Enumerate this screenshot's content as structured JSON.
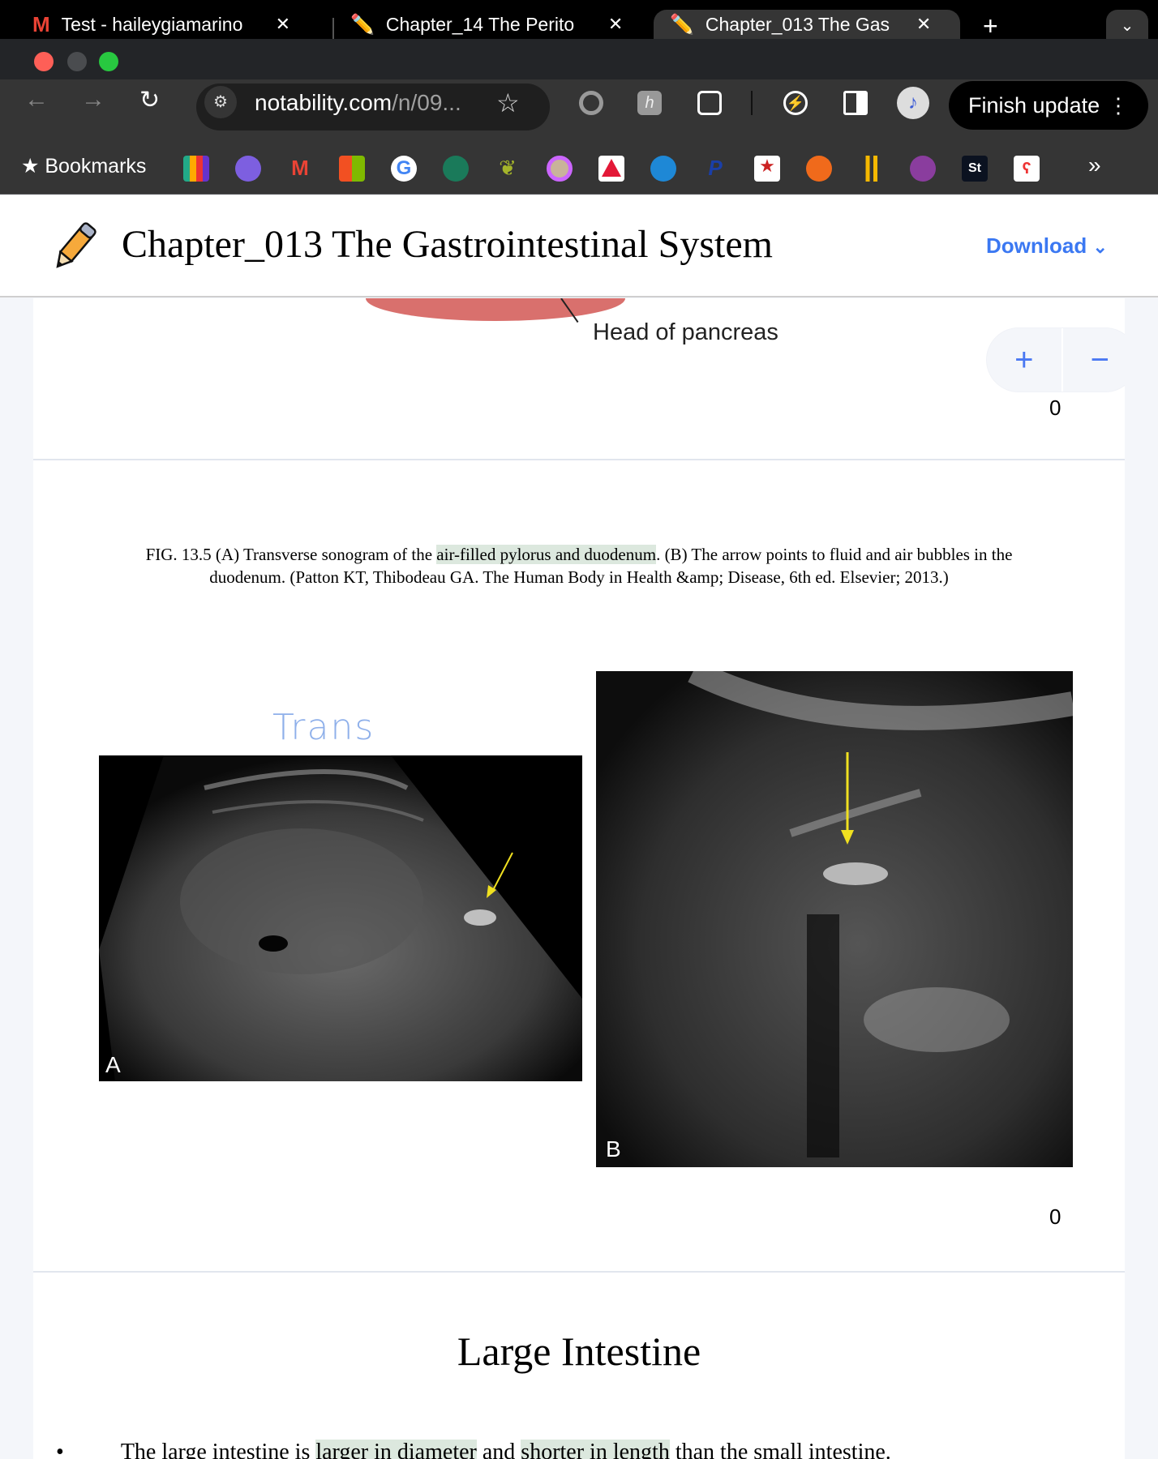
{
  "browser": {
    "tabs": [
      {
        "icon": "gmail-icon",
        "label": "Test - haileygiamarino",
        "active": false
      },
      {
        "icon": "notability-icon",
        "label": "Chapter_14 The Perito",
        "active": false
      },
      {
        "icon": "notability-icon",
        "label": "Chapter_013 The Gas",
        "active": true
      }
    ],
    "new_tab": "+",
    "tab_menu": "⌄",
    "url_domain": "notability.com",
    "url_path": "/n/09...",
    "finish_update": "Finish update",
    "bookmarks_label": "Bookmarks",
    "bookmarks_more": "»"
  },
  "app": {
    "title": "Chapter_013 The Gastrointestinal System",
    "download_label": "Download",
    "accent": "#3b78f2"
  },
  "content": {
    "prev_figure_label": "Head of pancreas",
    "vote_plus": "+",
    "vote_minus": "−",
    "vote_count_1": "0",
    "caption_line_1_pre": "FIG. 13.5 (A) Transverse sonogram of the ",
    "caption_line_1_hl": "air-filled pylorus and duodenum",
    "caption_line_1_post": ". (B) The arrow points to fluid and air bubbles in the",
    "caption_line_2": "duodenum. (Patton KT, Thibodeau GA. The Human Body in Health &amp; Disease, 6th ed. Elsevier; 2013.)",
    "annotation": "Trans",
    "image_a_label": "A",
    "image_b_label": "B",
    "vote_count_2": "0",
    "section_heading": "Large Intestine",
    "bullet_pre": "The large intestine is ",
    "bullet_hl1": "larger in diameter",
    "bullet_mid": " and ",
    "bullet_hl2": "shorter in length",
    "bullet_post": " than the small intestine."
  }
}
